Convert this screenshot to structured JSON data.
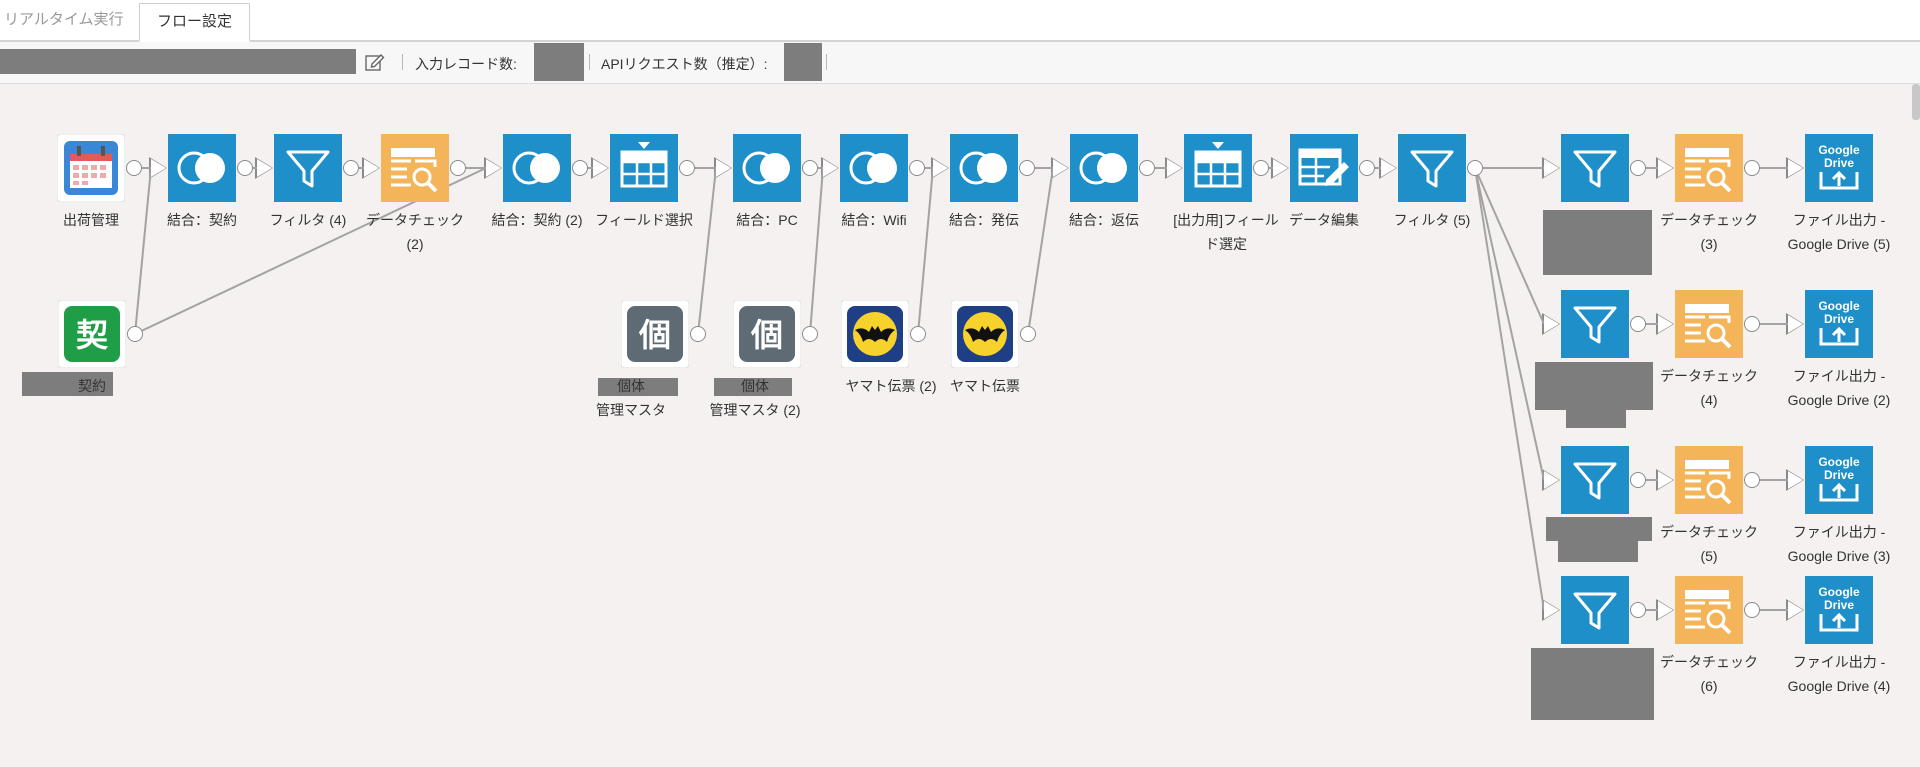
{
  "tabs": [
    {
      "id": "realtime",
      "label": "リアルタイム実行",
      "active": false
    },
    {
      "id": "flow",
      "label": "フロー設定",
      "active": true
    }
  ],
  "info": {
    "input_records_label": "入力レコード数:",
    "api_requests_label": "APIリクエスト数（推定）:"
  },
  "colors": {
    "blue": "#1e8fc9",
    "orange": "#f4b55a",
    "green": "#1f9d47",
    "gray": "#5f6b74",
    "yamato_bg": "#1e3f86",
    "yamato_circle": "#f7d22c",
    "calendar": "#3a87d8"
  },
  "nodes": [
    {
      "id": "n1",
      "type": "calendar",
      "icon": "calendar-icon",
      "label": "出荷管理"
    },
    {
      "id": "n2",
      "type": "kanji",
      "icon": "kanji-kei-icon",
      "glyph": "契",
      "label": "契約"
    },
    {
      "id": "n3",
      "type": "join",
      "icon": "join-icon",
      "label": "結合：契約"
    },
    {
      "id": "n4",
      "type": "filter",
      "icon": "filter-icon",
      "label": "フィルタ (4)"
    },
    {
      "id": "n5",
      "type": "datacheck",
      "icon": "data-check-icon",
      "label": "データチェック\n(2)"
    },
    {
      "id": "n6",
      "type": "join",
      "icon": "join-icon",
      "label": "結合：契約 (2)"
    },
    {
      "id": "n7",
      "type": "field",
      "icon": "field-select-icon",
      "label": "フィールド選択"
    },
    {
      "id": "n8",
      "type": "join",
      "icon": "join-icon",
      "label": "結合：PC"
    },
    {
      "id": "n9",
      "type": "join",
      "icon": "join-icon",
      "label": "結合：Wifi"
    },
    {
      "id": "n10",
      "type": "join",
      "icon": "join-icon",
      "label": "結合：発伝"
    },
    {
      "id": "n11",
      "type": "join",
      "icon": "join-icon",
      "label": "結合：返伝"
    },
    {
      "id": "n12",
      "type": "field",
      "icon": "field-select-icon",
      "label": "[出力用]フィール\nド選定"
    },
    {
      "id": "n13",
      "type": "edit",
      "icon": "data-edit-icon",
      "label": "データ編集"
    },
    {
      "id": "n14",
      "type": "filter",
      "icon": "filter-icon",
      "label": "フィルタ (5)"
    },
    {
      "id": "n15",
      "type": "kanji",
      "icon": "kanji-ko-icon",
      "glyph": "個",
      "label": "個体\n管理マスタ"
    },
    {
      "id": "n16",
      "type": "kanji",
      "icon": "kanji-ko-icon",
      "glyph": "個",
      "label": "個体\n管理マスタ (2)"
    },
    {
      "id": "n17",
      "type": "yamato",
      "icon": "yamato-cat-icon",
      "label": "ヤマト伝票 (2)"
    },
    {
      "id": "n18",
      "type": "yamato",
      "icon": "yamato-cat-icon",
      "label": "ヤマト伝票"
    },
    {
      "id": "f1",
      "type": "filter",
      "icon": "filter-icon",
      "label": ""
    },
    {
      "id": "c1",
      "type": "datacheck",
      "icon": "data-check-icon",
      "label": "データチェック\n(3)"
    },
    {
      "id": "g1",
      "type": "gdrive",
      "icon": "google-drive-upload-icon",
      "gtext1": "Google",
      "gtext2": "Drive",
      "label": "ファイル出力 -\nGoogle Drive (5)"
    },
    {
      "id": "f2",
      "type": "filter",
      "icon": "filter-icon",
      "label": ""
    },
    {
      "id": "c2",
      "type": "datacheck",
      "icon": "data-check-icon",
      "label": "データチェック\n(4)"
    },
    {
      "id": "g2",
      "type": "gdrive",
      "icon": "google-drive-upload-icon",
      "gtext1": "Google",
      "gtext2": "Drive",
      "label": "ファイル出力 -\nGoogle Drive (2)"
    },
    {
      "id": "f3",
      "type": "filter",
      "icon": "filter-icon",
      "label": ""
    },
    {
      "id": "c3",
      "type": "datacheck",
      "icon": "data-check-icon",
      "label": "データチェック\n(5)"
    },
    {
      "id": "g3",
      "type": "gdrive",
      "icon": "google-drive-upload-icon",
      "gtext1": "Google",
      "gtext2": "Drive",
      "label": "ファイル出力 -\nGoogle Drive (3)"
    },
    {
      "id": "f4",
      "type": "filter",
      "icon": "filter-icon",
      "label": ""
    },
    {
      "id": "c4",
      "type": "datacheck",
      "icon": "data-check-icon",
      "label": "データチェック\n(6)"
    },
    {
      "id": "g4",
      "type": "gdrive",
      "icon": "google-drive-upload-icon",
      "gtext1": "Google",
      "gtext2": "Drive",
      "label": "ファイル出力 -\nGoogle Drive (4)"
    }
  ],
  "edges": [
    [
      "n1",
      "n3"
    ],
    [
      "n2",
      "n3"
    ],
    [
      "n3",
      "n4"
    ],
    [
      "n4",
      "n5"
    ],
    [
      "n5",
      "n6"
    ],
    [
      "n2",
      "n6"
    ],
    [
      "n6",
      "n7"
    ],
    [
      "n7",
      "n8"
    ],
    [
      "n15",
      "n8"
    ],
    [
      "n8",
      "n9"
    ],
    [
      "n16",
      "n9"
    ],
    [
      "n9",
      "n10"
    ],
    [
      "n17",
      "n10"
    ],
    [
      "n10",
      "n11"
    ],
    [
      "n18",
      "n11"
    ],
    [
      "n11",
      "n12"
    ],
    [
      "n12",
      "n13"
    ],
    [
      "n13",
      "n14"
    ],
    [
      "n14",
      "f1"
    ],
    [
      "n14",
      "f2"
    ],
    [
      "n14",
      "f3"
    ],
    [
      "n14",
      "f4"
    ],
    [
      "f1",
      "c1"
    ],
    [
      "c1",
      "g1"
    ],
    [
      "f2",
      "c2"
    ],
    [
      "c2",
      "g2"
    ],
    [
      "f3",
      "c3"
    ],
    [
      "c3",
      "g3"
    ],
    [
      "f4",
      "c4"
    ],
    [
      "c4",
      "g4"
    ]
  ]
}
